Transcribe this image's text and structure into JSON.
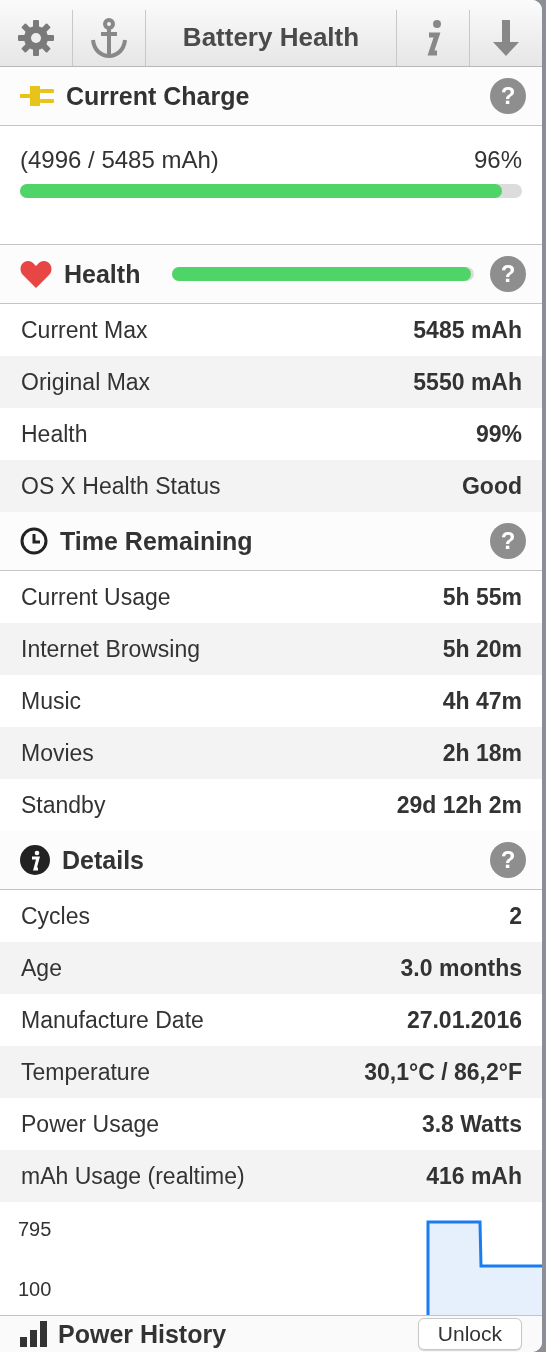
{
  "toolbar": {
    "title": "Battery Health"
  },
  "sections": [
    {
      "kind": "charge",
      "title": "Current Charge",
      "help": "?",
      "reading": "(4996 / 5485 mAh)",
      "percent": "96%",
      "level": 0.96
    },
    {
      "kind": "health",
      "title": "Health",
      "help": "?",
      "level": 0.99,
      "rows": [
        {
          "label": "Current Max",
          "value": "5485 mAh"
        },
        {
          "label": "Original Max",
          "value": "5550 mAh"
        },
        {
          "label": "Health",
          "value": "99%"
        },
        {
          "label": "OS X Health Status",
          "value": "Good"
        }
      ]
    },
    {
      "kind": "time",
      "title": "Time Remaining",
      "help": "?",
      "rows": [
        {
          "label": "Current Usage",
          "value": "5h 55m"
        },
        {
          "label": "Internet Browsing",
          "value": "5h 20m"
        },
        {
          "label": "Music",
          "value": "4h 47m"
        },
        {
          "label": "Movies",
          "value": "2h 18m"
        },
        {
          "label": "Standby",
          "value": "29d 12h 2m"
        }
      ]
    },
    {
      "kind": "details",
      "title": "Details",
      "help": "?",
      "rows": [
        {
          "label": "Cycles",
          "value": "2"
        },
        {
          "label": "Age",
          "value": "3.0 months"
        },
        {
          "label": "Manufacture Date",
          "value": "27.01.2016"
        },
        {
          "label": "Temperature",
          "value": "30,1°C / 86,2°F"
        },
        {
          "label": "Power Usage",
          "value": "3.8 Watts"
        },
        {
          "label": "mAh Usage (realtime)",
          "value": "416 mAh"
        }
      ]
    }
  ],
  "graph": {
    "top_label": "795",
    "bottom_label": "100"
  },
  "footer": {
    "title": "Power History",
    "button": "Unlock"
  }
}
